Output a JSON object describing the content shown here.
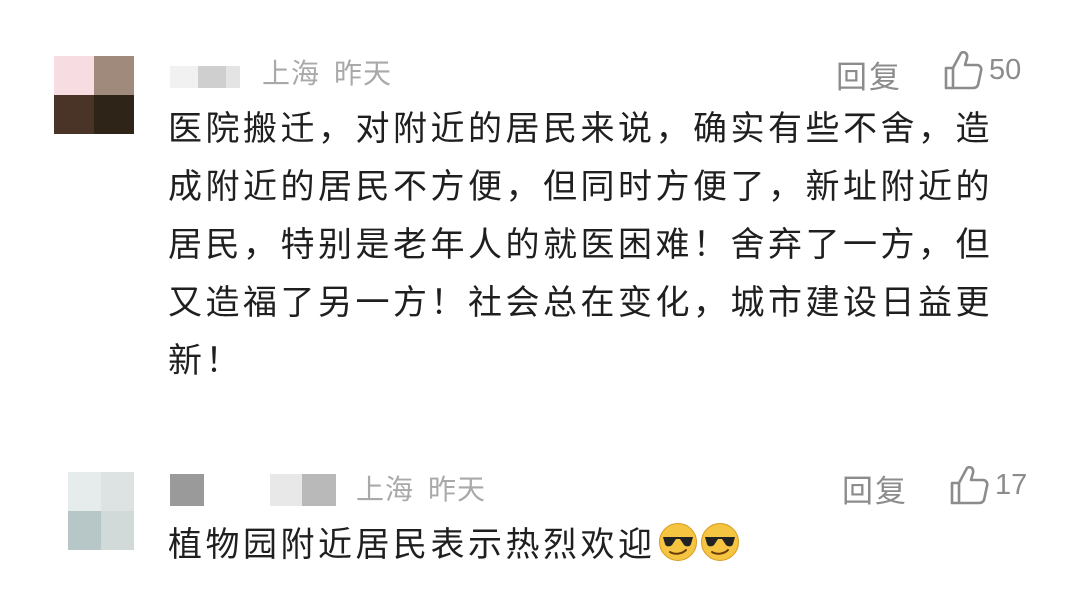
{
  "comments": [
    {
      "location": "上海",
      "time": "昨天",
      "reply_label": "回复",
      "like_count": "50",
      "text": "医院搬迁，对附近的居民来说，确实有些不舍，造成附近的居民不方便，但同时方便了，新址附近的居民，特别是老年人的就医困难！舍弃了一方，但又造福了另一方！社会总在变化，城市建设日益更新！",
      "avatar_colors": [
        "#f7dde2",
        "#9f8a7c",
        "#4a3427",
        "#2f2418"
      ]
    },
    {
      "location": "上海",
      "time": "昨天",
      "reply_label": "回复",
      "like_count": "17",
      "text": "植物园附近居民表示热烈欢迎",
      "emojis": [
        "sunglasses-emoji",
        "sunglasses-emoji"
      ],
      "avatar_colors": [
        "#e6ecec",
        "#dde3e3",
        "#b7c6c6",
        "#d2d9d9"
      ]
    }
  ],
  "colors": {
    "meta": "#a9a9a9",
    "action": "#8c8c8c",
    "body": "#1f1f1f",
    "name_redaction": "#9a9a9a"
  },
  "icons": {
    "like": "thumbs-up-icon"
  }
}
